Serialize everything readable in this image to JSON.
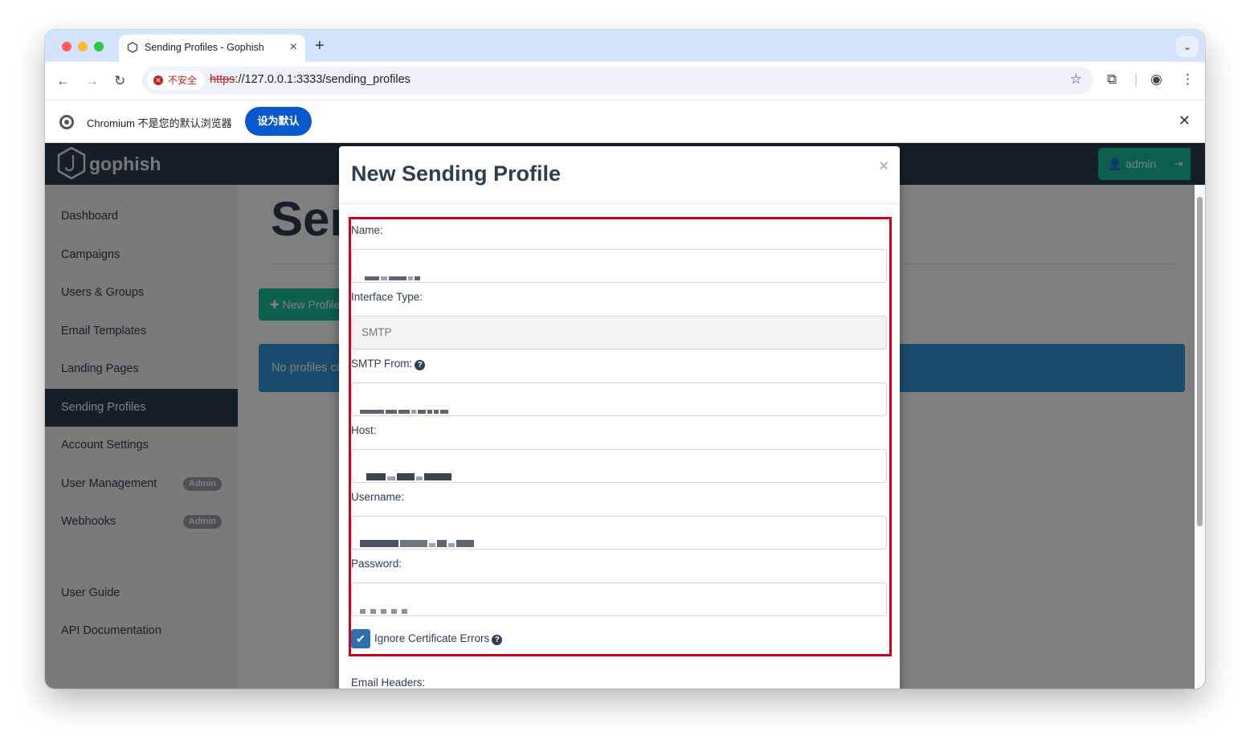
{
  "browser": {
    "tab_title": "Sending Profiles - Gophish",
    "security_label": "不安全",
    "url_scheme": "https",
    "url_rest": "://127.0.0.1:3333/sending_profiles",
    "infobar_text": "Chromium 不是您的默认浏览器",
    "infobar_button": "设为默认"
  },
  "app": {
    "brand": "gophish",
    "admin_label": "admin",
    "page_title": "Sending Profiles",
    "new_profile_button": "New Profile",
    "empty_message": "No profiles created yet. Let's create one!"
  },
  "sidebar": {
    "items": [
      {
        "label": "Dashboard"
      },
      {
        "label": "Campaigns"
      },
      {
        "label": "Users & Groups"
      },
      {
        "label": "Email Templates"
      },
      {
        "label": "Landing Pages"
      },
      {
        "label": "Sending Profiles",
        "active": true
      },
      {
        "label": "Account Settings"
      },
      {
        "label": "User Management",
        "badge": "Admin"
      },
      {
        "label": "Webhooks",
        "badge": "Admin"
      },
      {
        "label": "User Guide"
      },
      {
        "label": "API Documentation"
      }
    ]
  },
  "modal": {
    "title": "New Sending Profile",
    "close": "×",
    "fields": {
      "name_label": "Name:",
      "interface_label": "Interface Type:",
      "interface_value": "SMTP",
      "from_label": "SMTP From:",
      "host_label": "Host:",
      "username_label": "Username:",
      "password_label": "Password:",
      "ignore_cert_label": "Ignore Certificate Errors",
      "ignore_cert_checked": true,
      "email_headers_label": "Email Headers:"
    }
  },
  "colors": {
    "navbar": "#2c3e50",
    "accent_green": "#18bc9c",
    "info_blue": "#3498db",
    "highlight_red": "#d0021b",
    "infobar_button": "#0b57d0"
  }
}
